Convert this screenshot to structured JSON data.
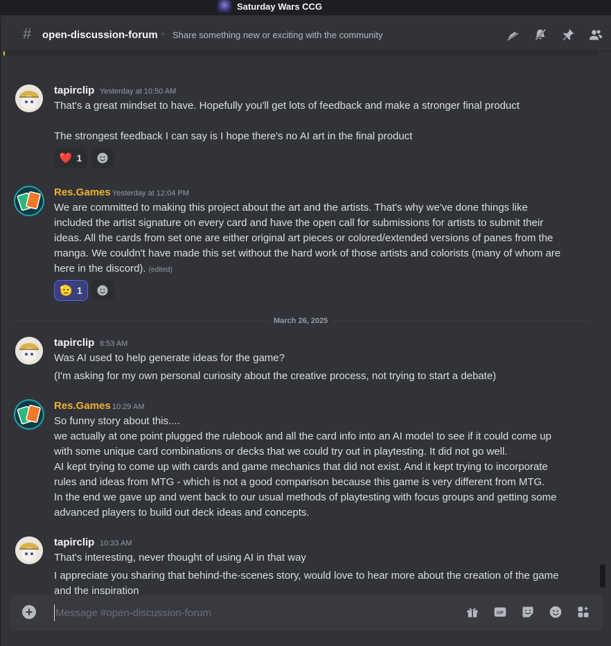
{
  "titlebar": {
    "server_name": "Saturday Wars CCG"
  },
  "channel": {
    "name": "open-discussion-forum",
    "topic": "Share something new or exciting with the community",
    "icons": [
      "threads-icon",
      "notifications-muted-icon",
      "pin-icon",
      "member-list-icon"
    ]
  },
  "messages": [
    {
      "author": "tapirclip",
      "timestamp": "Yesterday at 10:50 AM",
      "lines": [
        "That's a great mindset to have. Hopefully you'll get lots of feedback and make a stronger final product",
        "The strongest feedback I can say is I hope there's no AI art in the final product"
      ],
      "reaction": {
        "emoji": "❤️",
        "count": "1"
      }
    },
    {
      "author": "Res.Games",
      "timestamp": "Yesterday at 12:04 PM",
      "lines": [
        "We are committed to making this project about the art and the artists. That's why we've done things like",
        "included the artist signature on every card and have the open call for submissions for artists to submit their",
        "ideas. All the cards from set one are either original art pieces or colored/extended versions of panes from the",
        "manga. We couldn't have made this set without the hard work of those artists and colorists (many of whom are",
        "here in the discord)."
      ],
      "edited": "(edited)",
      "reaction": {
        "emoji": "🫡",
        "count": "1"
      }
    },
    {
      "author": "tapirclip",
      "timestamp": "8:53 AM",
      "lines": [
        "Was AI used to help generate ideas for the game?",
        "(I'm asking for my own personal curiosity about the creative process, not trying to start a debate)"
      ]
    },
    {
      "author": "Res.Games",
      "timestamp": "10:29 AM",
      "lines": [
        "So funny story about this....",
        "we actually at one point plugged the rulebook and all the card info into an AI model to see if it could come up",
        "with some unique card combinations or decks that we could try out in playtesting. It did not go well.",
        "AI kept trying to come up with cards and game mechanics that did not exist. And it kept trying to incorporate",
        "rules and ideas from MTG - which is not a good comparison because this game is very different from MTG.",
        "In the end we gave up and went back to our usual methods of playtesting with focus groups and getting some",
        "advanced players to build out deck ideas and concepts."
      ]
    },
    {
      "author": "tapirclip",
      "timestamp": "10:33 AM",
      "lines": [
        "That's interesting, never thought of using AI in that way",
        "I appreciate you sharing that behind-the-scenes story, would love to hear more about the creation of the game",
        "and the inspiration"
      ]
    }
  ],
  "date_divider": "March 26, 2025",
  "composer": {
    "placeholder": "Message #open-discussion-forum",
    "icons": [
      "gift-icon",
      "gif-icon",
      "sticker-icon",
      "emoji-icon",
      "apps-icon"
    ]
  },
  "colors": {
    "background": "#313338",
    "header_bg": "#1e1f22",
    "accent_gold": "#f0b232",
    "blurple": "#5865f2",
    "text": "#dbdee1",
    "muted": "#949ba4"
  }
}
